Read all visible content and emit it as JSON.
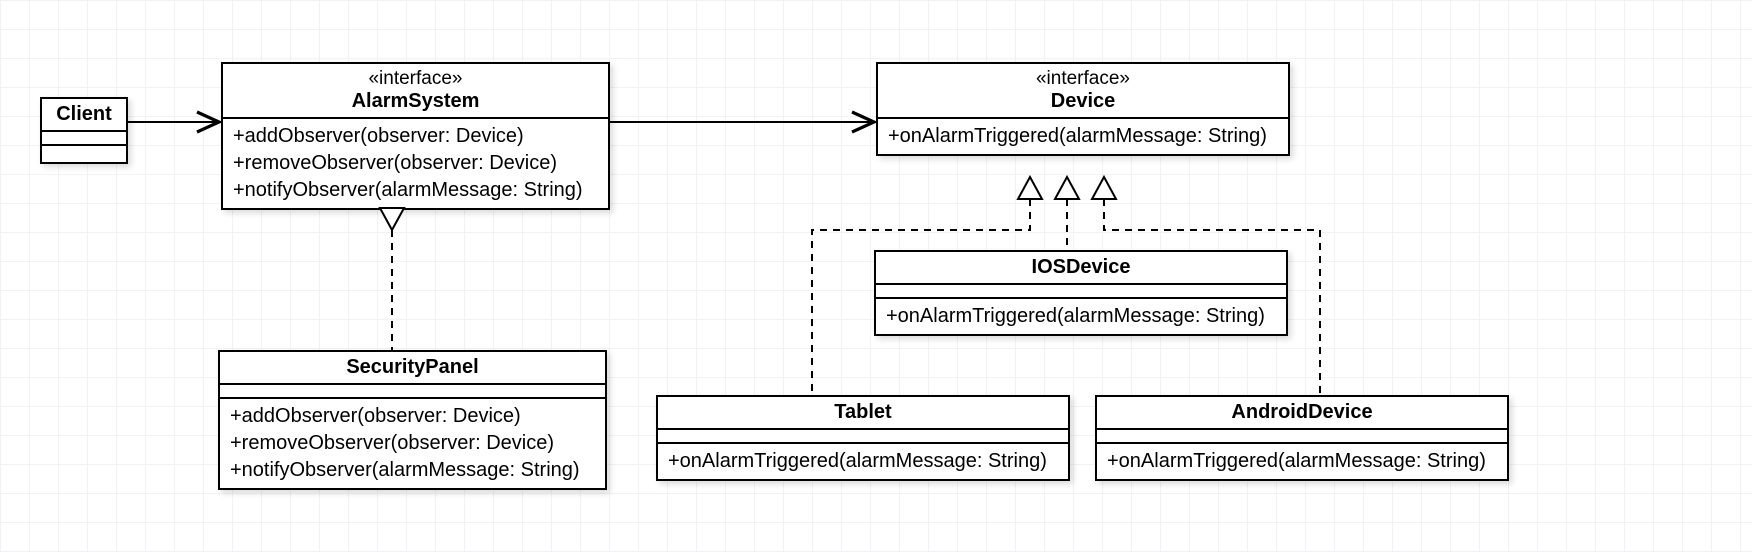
{
  "stereotype": "«interface»",
  "classes": {
    "Client": {
      "name": "Client",
      "ops": []
    },
    "AlarmSystem": {
      "name": "AlarmSystem",
      "ops": [
        "+addObserver(observer: Device)",
        "+removeObserver(observer: Device)",
        "+notifyObserver(alarmMessage: String)"
      ]
    },
    "Device": {
      "name": "Device",
      "ops": [
        "+onAlarmTriggered(alarmMessage: String)"
      ]
    },
    "SecurityPanel": {
      "name": "SecurityPanel",
      "ops": [
        "+addObserver(observer: Device)",
        "+removeObserver(observer: Device)",
        "+notifyObserver(alarmMessage: String)"
      ]
    },
    "IOSDevice": {
      "name": "IOSDevice",
      "ops": [
        "+onAlarmTriggered(alarmMessage: String)"
      ]
    },
    "Tablet": {
      "name": "Tablet",
      "ops": [
        "+onAlarmTriggered(alarmMessage: String)"
      ]
    },
    "AndroidDevice": {
      "name": "AndroidDevice",
      "ops": [
        "+onAlarmTriggered(alarmMessage: String)"
      ]
    }
  }
}
